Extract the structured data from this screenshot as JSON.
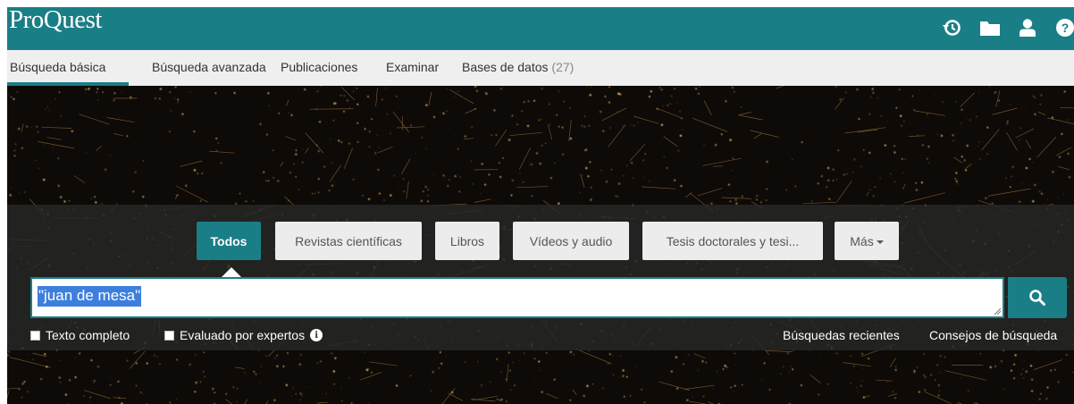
{
  "header": {
    "logo": "ProQuest",
    "icons": [
      "history-icon",
      "folder-icon",
      "user-icon",
      "help-icon"
    ]
  },
  "nav": {
    "tabs": [
      {
        "label": "Búsqueda básica",
        "active": true
      },
      {
        "label": "Búsqueda avanzada"
      },
      {
        "label": "Publicaciones"
      },
      {
        "label": "Examinar"
      },
      {
        "label": "Bases de datos",
        "count": "(27)"
      }
    ]
  },
  "filters": [
    {
      "label": "Todos",
      "active": true
    },
    {
      "label": "Revistas científicas"
    },
    {
      "label": "Libros"
    },
    {
      "label": "Vídeos y audio"
    },
    {
      "label": "Tesis doctorales y tesi..."
    },
    {
      "label": "Más"
    }
  ],
  "search": {
    "query": "\"juan de mesa\"",
    "button_icon": "search-icon"
  },
  "options": {
    "full_text": "Texto completo",
    "peer_reviewed": "Evaluado por expertos",
    "recent_searches": "Búsquedas recientes",
    "search_tips": "Consejos de búsqueda"
  },
  "colors": {
    "brand": "#1a7e86",
    "selection": "#3d7fdd"
  }
}
